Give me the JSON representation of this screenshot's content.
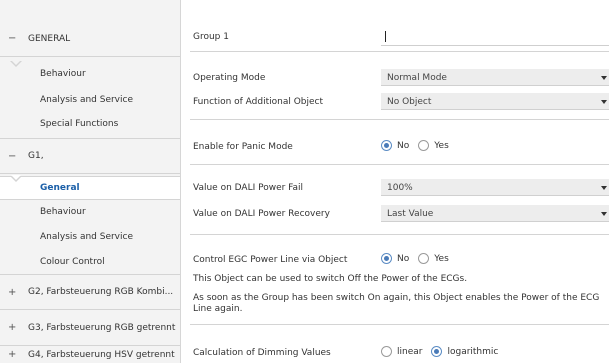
{
  "sidebar": {
    "groups": {
      "general": {
        "sign": "−",
        "label": "GENERAL"
      },
      "g1": {
        "sign": "−",
        "label": "G1,"
      },
      "g2": {
        "sign": "+",
        "label": "G2, Farbsteuerung RGB Kombi..."
      },
      "g3": {
        "sign": "+",
        "label": "G3, Farbsteuerung RGB getrennt"
      },
      "g4": {
        "sign": "+",
        "label": "G4, Farbsteuerung HSV getrennt"
      }
    },
    "general_items": [
      "Behaviour",
      "Analysis and Service",
      "Special Functions"
    ],
    "g1_items": [
      "General",
      "Behaviour",
      "Analysis and Service",
      "Colour Control"
    ]
  },
  "main": {
    "group_name": {
      "label": "Group 1",
      "value": ""
    },
    "operating_mode": {
      "label": "Operating Mode",
      "value": "Normal Mode"
    },
    "additional_object": {
      "label": "Function of Additional Object",
      "value": "No Object"
    },
    "panic_mode": {
      "label": "Enable for Panic Mode",
      "options": [
        "No",
        "Yes"
      ],
      "selected": "No"
    },
    "power_fail": {
      "label": "Value on DALI Power Fail",
      "value": "100%"
    },
    "power_recovery": {
      "label": "Value on DALI Power Recovery",
      "value": "Last Value"
    },
    "egc_power": {
      "label": "Control EGC Power Line via Object",
      "options": [
        "No",
        "Yes"
      ],
      "selected": "No"
    },
    "info_1": "This Object can be used to switch Off the Power of the ECGs.",
    "info_2": "As soon as the Group has been switch On again, this Object enables the Power of the ECG Line again.",
    "dimming": {
      "label": "Calculation of Dimming Values",
      "options": [
        "linear",
        "logarithmic"
      ],
      "selected": "logarithmic"
    }
  }
}
